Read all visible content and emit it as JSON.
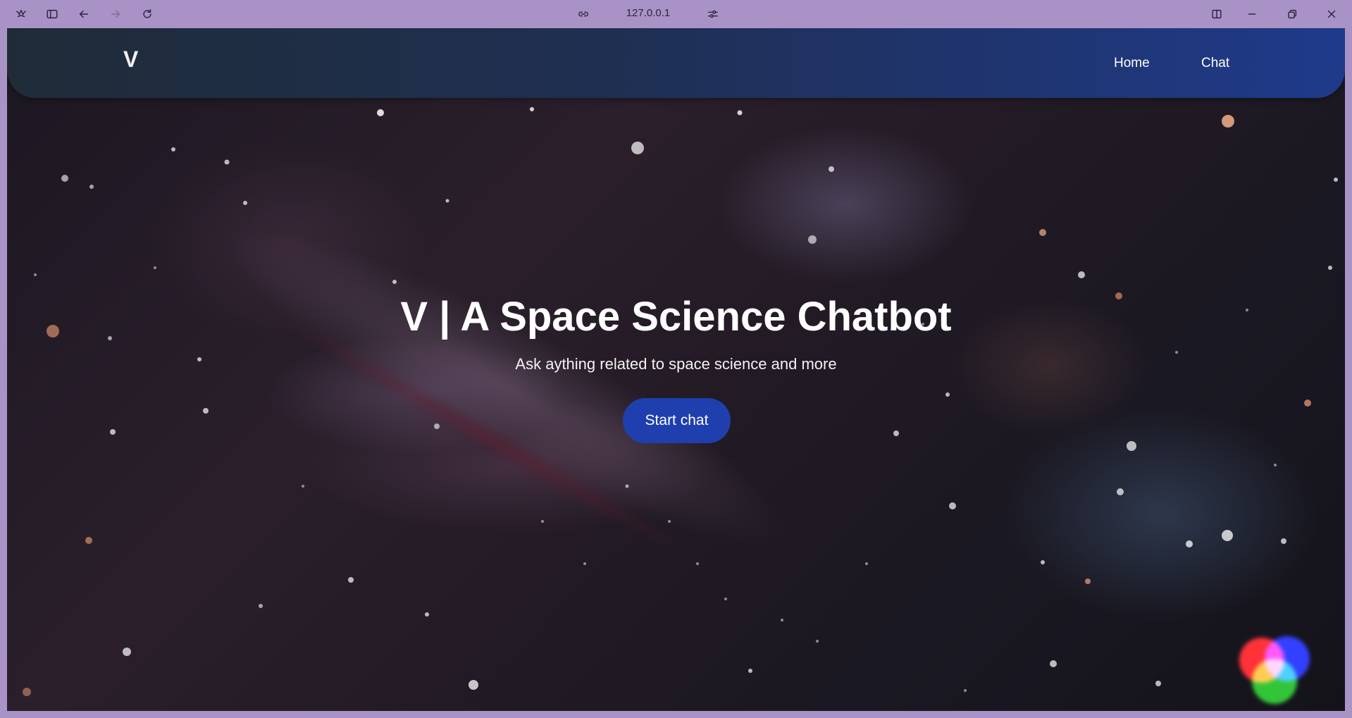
{
  "browser": {
    "url": "127.0.0.1",
    "icons": {
      "app": "browser-logo-icon",
      "sidebar": "sidebar-toggle-icon",
      "back": "back-arrow-icon",
      "forward": "forward-arrow-icon",
      "reload": "reload-icon",
      "site_info": "link-icon",
      "page_settings": "sliders-icon",
      "split": "split-view-icon",
      "minimize": "minimize-icon",
      "restore": "restore-icon",
      "close": "close-icon"
    }
  },
  "navbar": {
    "brand": "V",
    "links": [
      "Home",
      "Chat"
    ],
    "colors": {
      "start": "#1f2c38",
      "end": "#1f3a8a"
    }
  },
  "hero": {
    "title": "V | A Space Science Chatbot",
    "subtitle": "Ask aything related to space science and more",
    "cta_label": "Start chat",
    "cta_color": "#1f3fae"
  },
  "widget": {
    "icon": "rgb-color-circles-icon",
    "colors": [
      "#ff2020",
      "#2030ff",
      "#20c020"
    ]
  }
}
